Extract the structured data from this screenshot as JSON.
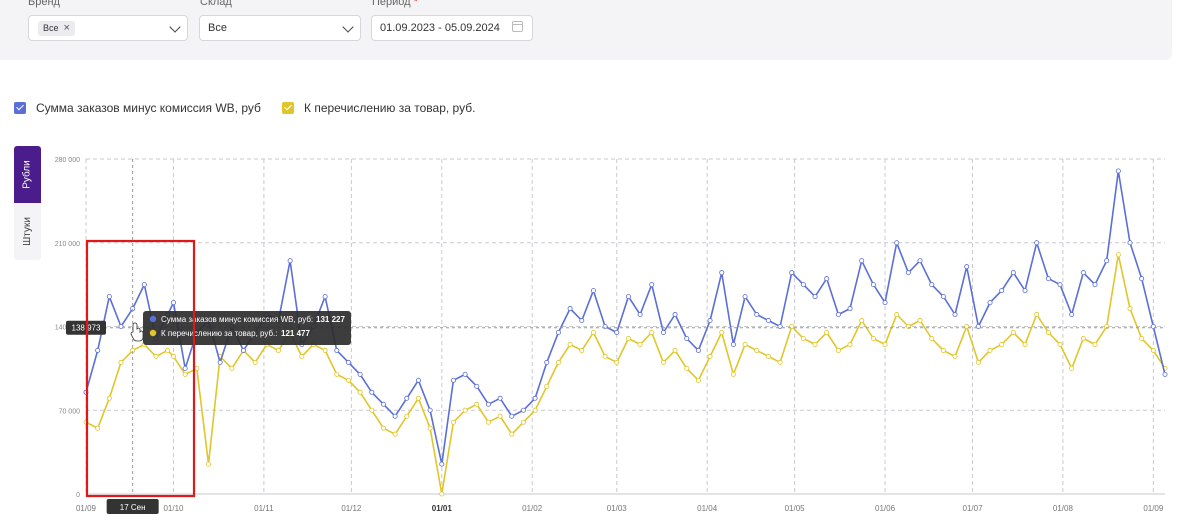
{
  "filters": {
    "brand": {
      "label": "Бренд",
      "chip": "Все"
    },
    "warehouse": {
      "label": "Склад",
      "value": "Все"
    },
    "period": {
      "label": "Период",
      "required": "*",
      "value": "01.09.2023 - 05.09.2024"
    }
  },
  "tabs": {
    "rubles": "Рубли",
    "pieces": "Штуки"
  },
  "legend": [
    {
      "label": "Сумма заказов минус комиссия WB, руб",
      "color": "#5b6fd6"
    },
    {
      "label": "К перечислению за товар, руб.",
      "color": "#e0c62a"
    }
  ],
  "tooltip": {
    "rows": [
      {
        "label": "Сумма заказов минус комиссия WB, руб:",
        "value": "131 227",
        "color": "#5b6fd6"
      },
      {
        "label": "К перечислению за товар, руб.:",
        "value": "121 477",
        "color": "#e0c62a"
      }
    ],
    "y_readout": "138 973",
    "x_readout": "17 Сен"
  },
  "chart_data": {
    "type": "line",
    "title": "",
    "xlabel": "",
    "ylabel": "",
    "x_range": [
      "2023-09-01",
      "2024-09-05"
    ],
    "ylim": [
      0,
      280000
    ],
    "y_ticks": [
      0,
      70000,
      140000,
      210000,
      280000
    ],
    "y_tick_labels": [
      "0",
      "70 000",
      "140 000",
      "210 000",
      "280 000"
    ],
    "x_tick_labels": [
      "01/09",
      "01/10",
      "01/11",
      "01/12",
      "01/01",
      "01/02",
      "01/03",
      "01/04",
      "01/05",
      "01/06",
      "01/07",
      "01/08",
      "01/09"
    ],
    "x_tick_days": [
      0,
      30,
      61,
      91,
      122,
      153,
      182,
      213,
      243,
      274,
      304,
      335,
      366
    ],
    "bold_tick_index": 4,
    "series": [
      {
        "color": "#5b6fd6",
        "points": [
          [
            0,
            85000
          ],
          [
            4,
            120000
          ],
          [
            8,
            165000
          ],
          [
            12,
            140000
          ],
          [
            16,
            155000
          ],
          [
            20,
            175000
          ],
          [
            24,
            130000
          ],
          [
            28,
            150000
          ],
          [
            30,
            160000
          ],
          [
            34,
            105000
          ],
          [
            38,
            135000
          ],
          [
            42,
            145000
          ],
          [
            46,
            110000
          ],
          [
            50,
            140000
          ],
          [
            54,
            120000
          ],
          [
            58,
            135000
          ],
          [
            62,
            150000
          ],
          [
            66,
            145000
          ],
          [
            70,
            195000
          ],
          [
            74,
            125000
          ],
          [
            78,
            140000
          ],
          [
            82,
            165000
          ],
          [
            86,
            120000
          ],
          [
            90,
            110000
          ],
          [
            94,
            100000
          ],
          [
            98,
            85000
          ],
          [
            102,
            75000
          ],
          [
            106,
            65000
          ],
          [
            110,
            80000
          ],
          [
            114,
            95000
          ],
          [
            118,
            70000
          ],
          [
            122,
            25000
          ],
          [
            126,
            95000
          ],
          [
            130,
            100000
          ],
          [
            134,
            90000
          ],
          [
            138,
            75000
          ],
          [
            142,
            80000
          ],
          [
            146,
            65000
          ],
          [
            150,
            70000
          ],
          [
            154,
            80000
          ],
          [
            158,
            110000
          ],
          [
            162,
            135000
          ],
          [
            166,
            155000
          ],
          [
            170,
            145000
          ],
          [
            174,
            170000
          ],
          [
            178,
            140000
          ],
          [
            182,
            135000
          ],
          [
            186,
            165000
          ],
          [
            190,
            150000
          ],
          [
            194,
            175000
          ],
          [
            198,
            135000
          ],
          [
            202,
            150000
          ],
          [
            206,
            130000
          ],
          [
            210,
            120000
          ],
          [
            214,
            145000
          ],
          [
            218,
            185000
          ],
          [
            222,
            125000
          ],
          [
            226,
            165000
          ],
          [
            230,
            150000
          ],
          [
            234,
            145000
          ],
          [
            238,
            140000
          ],
          [
            242,
            185000
          ],
          [
            246,
            175000
          ],
          [
            250,
            165000
          ],
          [
            254,
            180000
          ],
          [
            258,
            150000
          ],
          [
            262,
            155000
          ],
          [
            266,
            195000
          ],
          [
            270,
            175000
          ],
          [
            274,
            160000
          ],
          [
            278,
            210000
          ],
          [
            282,
            185000
          ],
          [
            286,
            195000
          ],
          [
            290,
            175000
          ],
          [
            294,
            165000
          ],
          [
            298,
            150000
          ],
          [
            302,
            190000
          ],
          [
            306,
            140000
          ],
          [
            310,
            160000
          ],
          [
            314,
            170000
          ],
          [
            318,
            185000
          ],
          [
            322,
            170000
          ],
          [
            326,
            210000
          ],
          [
            330,
            180000
          ],
          [
            334,
            175000
          ],
          [
            338,
            150000
          ],
          [
            342,
            185000
          ],
          [
            346,
            175000
          ],
          [
            350,
            195000
          ],
          [
            354,
            270000
          ],
          [
            358,
            210000
          ],
          [
            362,
            180000
          ],
          [
            366,
            140000
          ],
          [
            370,
            100000
          ]
        ]
      },
      {
        "color": "#e0c62a",
        "points": [
          [
            0,
            60000
          ],
          [
            4,
            55000
          ],
          [
            8,
            80000
          ],
          [
            12,
            110000
          ],
          [
            16,
            120000
          ],
          [
            20,
            125000
          ],
          [
            24,
            115000
          ],
          [
            28,
            120000
          ],
          [
            30,
            115000
          ],
          [
            34,
            100000
          ],
          [
            38,
            105000
          ],
          [
            42,
            25000
          ],
          [
            46,
            115000
          ],
          [
            50,
            105000
          ],
          [
            54,
            120000
          ],
          [
            58,
            110000
          ],
          [
            62,
            125000
          ],
          [
            66,
            120000
          ],
          [
            70,
            135000
          ],
          [
            74,
            115000
          ],
          [
            78,
            125000
          ],
          [
            82,
            120000
          ],
          [
            86,
            100000
          ],
          [
            90,
            95000
          ],
          [
            94,
            85000
          ],
          [
            98,
            70000
          ],
          [
            102,
            55000
          ],
          [
            106,
            50000
          ],
          [
            110,
            65000
          ],
          [
            114,
            80000
          ],
          [
            118,
            55000
          ],
          [
            122,
            0
          ],
          [
            126,
            60000
          ],
          [
            130,
            70000
          ],
          [
            134,
            75000
          ],
          [
            138,
            60000
          ],
          [
            142,
            65000
          ],
          [
            146,
            50000
          ],
          [
            150,
            60000
          ],
          [
            154,
            70000
          ],
          [
            158,
            90000
          ],
          [
            162,
            110000
          ],
          [
            166,
            125000
          ],
          [
            170,
            120000
          ],
          [
            174,
            135000
          ],
          [
            178,
            115000
          ],
          [
            182,
            110000
          ],
          [
            186,
            130000
          ],
          [
            190,
            125000
          ],
          [
            194,
            135000
          ],
          [
            198,
            110000
          ],
          [
            202,
            120000
          ],
          [
            206,
            105000
          ],
          [
            210,
            95000
          ],
          [
            214,
            115000
          ],
          [
            218,
            135000
          ],
          [
            222,
            100000
          ],
          [
            226,
            125000
          ],
          [
            230,
            120000
          ],
          [
            234,
            115000
          ],
          [
            238,
            110000
          ],
          [
            242,
            140000
          ],
          [
            246,
            130000
          ],
          [
            250,
            125000
          ],
          [
            254,
            135000
          ],
          [
            258,
            120000
          ],
          [
            262,
            125000
          ],
          [
            266,
            145000
          ],
          [
            270,
            130000
          ],
          [
            274,
            125000
          ],
          [
            278,
            150000
          ],
          [
            282,
            140000
          ],
          [
            286,
            145000
          ],
          [
            290,
            130000
          ],
          [
            294,
            120000
          ],
          [
            298,
            115000
          ],
          [
            302,
            140000
          ],
          [
            306,
            110000
          ],
          [
            310,
            120000
          ],
          [
            314,
            125000
          ],
          [
            318,
            135000
          ],
          [
            322,
            125000
          ],
          [
            326,
            150000
          ],
          [
            330,
            135000
          ],
          [
            334,
            125000
          ],
          [
            338,
            105000
          ],
          [
            342,
            130000
          ],
          [
            346,
            125000
          ],
          [
            350,
            140000
          ],
          [
            354,
            200000
          ],
          [
            358,
            155000
          ],
          [
            362,
            130000
          ],
          [
            366,
            120000
          ],
          [
            370,
            105000
          ]
        ]
      }
    ]
  }
}
